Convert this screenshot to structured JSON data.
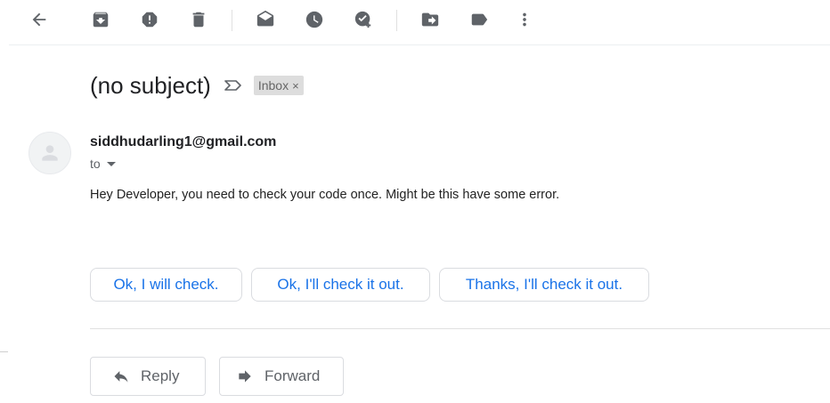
{
  "toolbar": {
    "icons": [
      "back-arrow-icon",
      "archive-icon",
      "report-spam-icon",
      "delete-icon",
      "mark-unread-icon",
      "snooze-icon",
      "add-to-tasks-icon",
      "move-to-icon",
      "label-icon",
      "more-vert-icon"
    ]
  },
  "email": {
    "subject": "(no subject)",
    "label": "Inbox",
    "label_remove": "×",
    "sender": "siddhudarling1@gmail.com",
    "to": "to",
    "body": "Hey Developer, you need to check your code once. Might be this have some error."
  },
  "smart_replies": [
    "Ok, I will check.",
    "Ok, I'll check it out.",
    "Thanks, I'll check it out."
  ],
  "actions": {
    "reply": "Reply",
    "forward": "Forward"
  },
  "colors": {
    "accent": "#1a73e8",
    "icon": "#5f6368",
    "chip_bg": "#dddddd"
  }
}
